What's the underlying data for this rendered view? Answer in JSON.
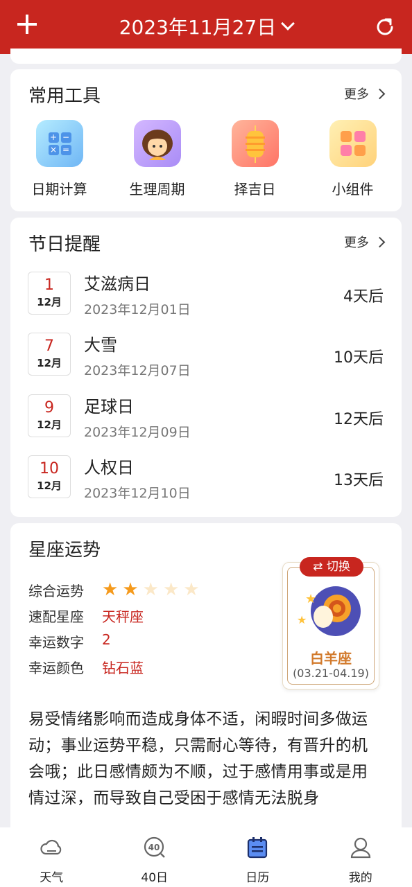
{
  "header": {
    "date_title": "2023年11月27日",
    "add_icon": "plus-icon",
    "refresh_icon": "refresh-icon",
    "bg_color": "#c8261f"
  },
  "tools_card": {
    "title": "常用工具",
    "more_label": "更多",
    "items": [
      {
        "label": "日期计算",
        "icon": "calculator-icon"
      },
      {
        "label": "生理周期",
        "icon": "period-avatar-icon"
      },
      {
        "label": "择吉日",
        "icon": "lantern-icon"
      },
      {
        "label": "小组件",
        "icon": "widget-puzzle-icon"
      }
    ],
    "calc_glyphs": [
      "+",
      "−",
      "×",
      "="
    ]
  },
  "holiday_card": {
    "title": "节日提醒",
    "more_label": "更多",
    "items": [
      {
        "day": "1",
        "month": "12月",
        "name": "艾滋病日",
        "date": "2023年12月01日",
        "after": "4天后"
      },
      {
        "day": "7",
        "month": "12月",
        "name": "大雪",
        "date": "2023年12月07日",
        "after": "10天后"
      },
      {
        "day": "9",
        "month": "12月",
        "name": "足球日",
        "date": "2023年12月09日",
        "after": "12天后"
      },
      {
        "day": "10",
        "month": "12月",
        "name": "人权日",
        "date": "2023年12月10日",
        "after": "13天后"
      }
    ]
  },
  "horoscope_card": {
    "title": "星座运势",
    "overall_label": "综合运势",
    "overall_stars": 2,
    "overall_max": 5,
    "match_label": "速配星座",
    "match_value": "天秤座",
    "number_label": "幸运数字",
    "number_value": "2",
    "color_label": "幸运颜色",
    "color_value": "钻石蓝",
    "switch_label": "切换",
    "sign_name": "白羊座",
    "sign_range": "(03.21-04.19)",
    "description": "易受情绪影响而造成身体不适，闲暇时间多做运动；事业运势平稳，只需耐心等待，有晋升的机会哦；此日感情颇为不顺，过于感情用事或是用情过深，而导致自己受困于感情无法脱身"
  },
  "tabbar": {
    "items": [
      {
        "label": "天气",
        "icon": "weather-cloud-icon",
        "active": false
      },
      {
        "label": "40日",
        "icon": "forty-day-icon",
        "active": false
      },
      {
        "label": "日历",
        "icon": "calendar-icon",
        "active": true
      },
      {
        "label": "我的",
        "icon": "profile-icon",
        "active": false
      }
    ],
    "icon_mark": "40"
  }
}
